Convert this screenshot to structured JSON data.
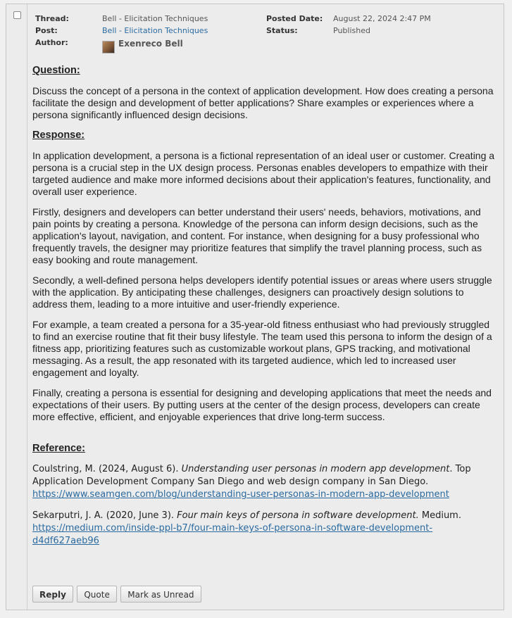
{
  "meta": {
    "thread_label": "Thread:",
    "thread_value": "Bell - Elicitation Techniques",
    "post_label": "Post:",
    "post_value": "Bell - Elicitation Techniques",
    "author_label": "Author:",
    "author_value": "Exenreco Bell",
    "posted_date_label": "Posted Date:",
    "posted_date_value": "August 22, 2024 2:47 PM",
    "status_label": "Status:",
    "status_value": "Published"
  },
  "question": {
    "heading": "Question:",
    "text": "Discuss the concept of a persona in the context of application development.  How does creating a persona facilitate the design and development of better applications?  Share examples or experiences where a persona significantly influenced design decisions."
  },
  "response": {
    "heading": "Response:",
    "paragraphs": [
      "In application development, a persona is a fictional representation of an ideal user or customer. Creating a persona is a crucial step in the UX design process. Personas enables developers to empathize with their targeted audience and make more informed decisions about their application's features, functionality, and overall user experience.",
      "Firstly, designers and developers can better understand their users' needs, behaviors, motivations, and pain points by creating a persona. Knowledge of the persona can inform design decisions, such as the application's layout, navigation, and content. For instance, when designing for a busy professional who frequently travels, the designer may prioritize features that simplify the travel planning process, such as easy booking and route management.",
      "Secondly, a well-defined persona helps developers identify potential issues or areas where users struggle with the application. By anticipating these challenges, designers can proactively design solutions to address them, leading to a more intuitive and user-friendly experience.",
      "For example, a team created a persona for a 35-year-old fitness enthusiast who had previously struggled to find an exercise routine that fit their busy lifestyle. The team used this persona to inform the design of a fitness app, prioritizing features such as customizable workout plans, GPS tracking, and motivational messaging. As a result, the app resonated with its targeted audience, which led to increased user engagement and loyalty.",
      "Finally, creating a persona is essential for designing and developing applications that meet the needs and expectations of their users. By putting users at the center of the design process, developers can create more effective, efficient, and enjoyable experiences that drive long-term success."
    ]
  },
  "reference": {
    "heading": "Reference:",
    "items": [
      {
        "prefix": "Coulstring, M. (2024, August 6). ",
        "title": "Understanding user personas in modern app development",
        "suffix": ". Top Application Development Company San Diego and web design company in San Diego.",
        "url": "https://www.seamgen.com/blog/understanding-user-personas-in-modern-app-development"
      },
      {
        "prefix": "Sekarputri, J. A. (2020, June 3). ",
        "title": "Four main keys of persona in software development.",
        "suffix": " Medium.",
        "url": "https://medium.com/inside-ppl-b7/four-main-keys-of-persona-in-software-development-d4df627aeb96"
      }
    ]
  },
  "buttons": {
    "reply": "Reply",
    "quote": "Quote",
    "mark_unread": "Mark as Unread"
  }
}
